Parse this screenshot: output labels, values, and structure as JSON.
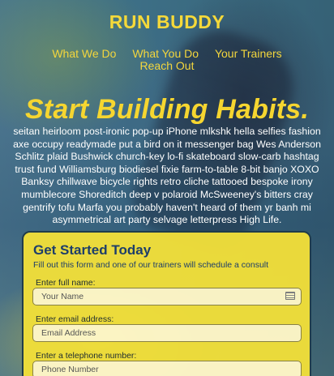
{
  "brand": "RUN BUDDY",
  "nav": {
    "items": [
      "What We Do",
      "What You Do",
      "Your Trainers",
      "Reach Out"
    ]
  },
  "hero": {
    "headline": "Start Building Habits.",
    "body": "seitan heirloom post-ironic pop-up iPhone mlkshk hella selfies fashion axe occupy readymade put a bird on it messenger bag Wes Anderson Schlitz plaid Bushwick church-key lo-fi skateboard slow-carb hashtag trust fund Williamsburg biodiesel fixie farm-to-table 8-bit banjo XOXO Banksy chillwave bicycle rights retro cliche tattooed bespoke irony mumblecore Shoreditch deep v polaroid McSweeney's bitters cray gentrify tofu Marfa you probably haven't heard of them yr banh mi asymmetrical art party selvage letterpress High Life."
  },
  "form": {
    "title": "Get Started Today",
    "subtitle": "Fill out this form and one of our trainers will schedule a consult",
    "fields": [
      {
        "label": "Enter full name:",
        "placeholder": "Your Name"
      },
      {
        "label": "Enter email address:",
        "placeholder": "Email Address"
      },
      {
        "label": "Enter a telephone number:",
        "placeholder": "Phone Number"
      }
    ]
  },
  "colors": {
    "accent": "#f5d93a",
    "form_bg": "#f0de3a",
    "form_title": "#1d3d6a"
  }
}
